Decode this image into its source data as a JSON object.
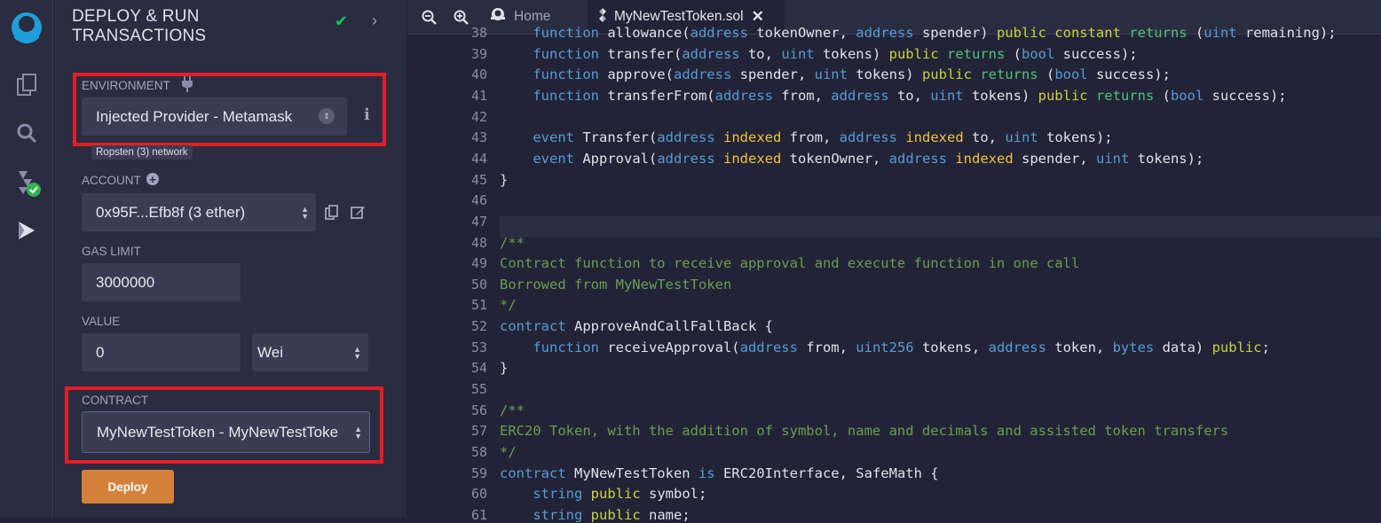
{
  "panel": {
    "title_line1": "DEPLOY & RUN",
    "title_line2": "TRANSACTIONS",
    "environment_label": "ENVIRONMENT",
    "environment_value": "Injected Provider - Metamask",
    "network_badge": "Ropsten (3) network",
    "account_label": "ACCOUNT",
    "account_value": "0x95F...Efb8f (3 ether)",
    "gas_limit_label": "GAS LIMIT",
    "gas_limit_value": "3000000",
    "value_label": "VALUE",
    "value_amount": "0",
    "value_unit": "Wei",
    "contract_label": "CONTRACT",
    "contract_value": "MyNewTestToken - MyNewTestToke",
    "deploy_label": "Deploy"
  },
  "tabs": {
    "home": "Home",
    "file": "MyNewTestToken.sol"
  },
  "colors": {
    "accent_red": "#e51d26",
    "deploy_orange": "#d4813c",
    "check_green": "#00c853"
  },
  "editor": {
    "lines": [
      {
        "n": "38",
        "parts": [
          [
            "",
            "    "
          ],
          [
            "kw",
            "function"
          ],
          [
            "",
            " allowance("
          ],
          [
            "ty",
            "address"
          ],
          [
            "",
            " tokenOwner, "
          ],
          [
            "ty",
            "address"
          ],
          [
            "",
            " spender) "
          ],
          [
            "mod",
            "public constant"
          ],
          [
            "",
            " "
          ],
          [
            "ret",
            "returns"
          ],
          [
            "",
            " ("
          ],
          [
            "ty",
            "uint"
          ],
          [
            "",
            " remaining);"
          ]
        ]
      },
      {
        "n": "39",
        "parts": [
          [
            "",
            "    "
          ],
          [
            "kw",
            "function"
          ],
          [
            "",
            " transfer("
          ],
          [
            "ty",
            "address"
          ],
          [
            "",
            " to, "
          ],
          [
            "ty",
            "uint"
          ],
          [
            "",
            " tokens) "
          ],
          [
            "mod",
            "public"
          ],
          [
            "",
            " "
          ],
          [
            "ret",
            "returns"
          ],
          [
            "",
            " ("
          ],
          [
            "ty",
            "bool"
          ],
          [
            "",
            " success);"
          ]
        ]
      },
      {
        "n": "40",
        "parts": [
          [
            "",
            "    "
          ],
          [
            "kw",
            "function"
          ],
          [
            "",
            " approve("
          ],
          [
            "ty",
            "address"
          ],
          [
            "",
            " spender, "
          ],
          [
            "ty",
            "uint"
          ],
          [
            "",
            " tokens) "
          ],
          [
            "mod",
            "public"
          ],
          [
            "",
            " "
          ],
          [
            "ret",
            "returns"
          ],
          [
            "",
            " ("
          ],
          [
            "ty",
            "bool"
          ],
          [
            "",
            " success);"
          ]
        ]
      },
      {
        "n": "41",
        "parts": [
          [
            "",
            "    "
          ],
          [
            "kw",
            "function"
          ],
          [
            "",
            " transferFrom("
          ],
          [
            "ty",
            "address"
          ],
          [
            "",
            " from, "
          ],
          [
            "ty",
            "address"
          ],
          [
            "",
            " to, "
          ],
          [
            "ty",
            "uint"
          ],
          [
            "",
            " tokens) "
          ],
          [
            "mod",
            "public"
          ],
          [
            "",
            " "
          ],
          [
            "ret",
            "returns"
          ],
          [
            "",
            " ("
          ],
          [
            "ty",
            "bool"
          ],
          [
            "",
            " success);"
          ]
        ]
      },
      {
        "n": "42",
        "parts": []
      },
      {
        "n": "43",
        "parts": [
          [
            "",
            "    "
          ],
          [
            "kw",
            "event"
          ],
          [
            "",
            " Transfer("
          ],
          [
            "ty",
            "address"
          ],
          [
            "",
            " "
          ],
          [
            "idx",
            "indexed"
          ],
          [
            "",
            " from, "
          ],
          [
            "ty",
            "address"
          ],
          [
            "",
            " "
          ],
          [
            "idx",
            "indexed"
          ],
          [
            "",
            " to, "
          ],
          [
            "ty",
            "uint"
          ],
          [
            "",
            " tokens);"
          ]
        ]
      },
      {
        "n": "44",
        "parts": [
          [
            "",
            "    "
          ],
          [
            "kw",
            "event"
          ],
          [
            "",
            " Approval("
          ],
          [
            "ty",
            "address"
          ],
          [
            "",
            " "
          ],
          [
            "idx",
            "indexed"
          ],
          [
            "",
            " tokenOwner, "
          ],
          [
            "ty",
            "address"
          ],
          [
            "",
            " "
          ],
          [
            "idx",
            "indexed"
          ],
          [
            "",
            " spender, "
          ],
          [
            "ty",
            "uint"
          ],
          [
            "",
            " tokens);"
          ]
        ]
      },
      {
        "n": "45",
        "parts": [
          [
            "",
            "}"
          ]
        ]
      },
      {
        "n": "46",
        "parts": []
      },
      {
        "n": "47",
        "parts": []
      },
      {
        "n": "48",
        "parts": [
          [
            "cm",
            "/**"
          ]
        ]
      },
      {
        "n": "49",
        "parts": [
          [
            "cm",
            "Contract function to receive approval and execute function in one call"
          ]
        ]
      },
      {
        "n": "50",
        "parts": [
          [
            "cm",
            "Borrowed from MyNewTestToken"
          ]
        ]
      },
      {
        "n": "51",
        "parts": [
          [
            "cm",
            "*/"
          ]
        ]
      },
      {
        "n": "52",
        "parts": [
          [
            "kw",
            "contract"
          ],
          [
            "",
            " ApproveAndCallFallBack {"
          ]
        ]
      },
      {
        "n": "53",
        "parts": [
          [
            "",
            "    "
          ],
          [
            "kw",
            "function"
          ],
          [
            "",
            " receiveApproval("
          ],
          [
            "ty",
            "address"
          ],
          [
            "",
            " from, "
          ],
          [
            "ty",
            "uint256"
          ],
          [
            "",
            " tokens, "
          ],
          [
            "ty",
            "address"
          ],
          [
            "",
            " token, "
          ],
          [
            "ty",
            "bytes"
          ],
          [
            "",
            " data) "
          ],
          [
            "mod",
            "public"
          ],
          [
            "",
            ";"
          ]
        ]
      },
      {
        "n": "54",
        "parts": [
          [
            "",
            "}"
          ]
        ]
      },
      {
        "n": "55",
        "parts": []
      },
      {
        "n": "56",
        "parts": [
          [
            "cm",
            "/**"
          ]
        ]
      },
      {
        "n": "57",
        "parts": [
          [
            "cm",
            "ERC20 Token, with the addition of symbol, name and decimals and assisted token transfers"
          ]
        ]
      },
      {
        "n": "58",
        "parts": [
          [
            "cm",
            "*/"
          ]
        ]
      },
      {
        "n": "59",
        "parts": [
          [
            "kw",
            "contract"
          ],
          [
            "",
            " MyNewTestToken "
          ],
          [
            "kw",
            "is"
          ],
          [
            "",
            " ERC20Interface, SafeMath {"
          ]
        ]
      },
      {
        "n": "60",
        "parts": [
          [
            "",
            "    "
          ],
          [
            "kw",
            "string"
          ],
          [
            "",
            " "
          ],
          [
            "mod",
            "public"
          ],
          [
            "",
            " symbol;"
          ]
        ]
      },
      {
        "n": "61",
        "parts": [
          [
            "",
            "    "
          ],
          [
            "kw",
            "string"
          ],
          [
            "",
            " "
          ],
          [
            "mod",
            "public"
          ],
          [
            "",
            " name;"
          ]
        ]
      }
    ]
  }
}
